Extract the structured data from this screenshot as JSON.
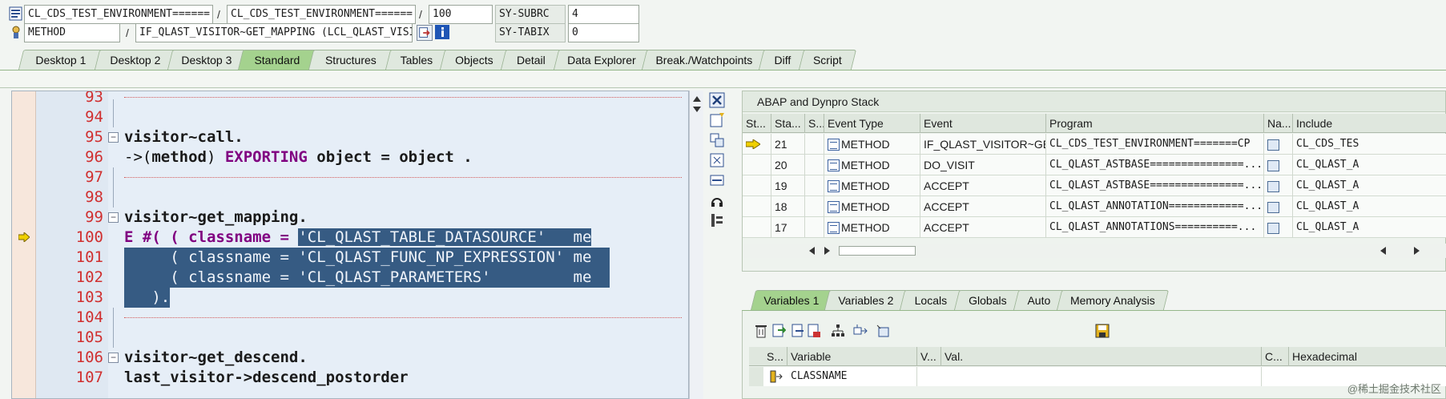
{
  "header": {
    "row1": {
      "program": "CL_CDS_TEST_ENVIRONMENT======",
      "include": "CL_CDS_TEST_ENVIRONMENT======",
      "line": "100",
      "sysvar_label": "SY-SUBRC",
      "sysvar_value": "4"
    },
    "row2": {
      "event_type": "METHOD",
      "event": "IF_QLAST_VISITOR~GET_MAPPING (LCL_QLAST_VISI...",
      "sysvar_label": "SY-TABIX",
      "sysvar_value": "0"
    },
    "separator": "/"
  },
  "tabs": [
    "Desktop 1",
    "Desktop 2",
    "Desktop 3",
    "Standard",
    "Structures",
    "Tables",
    "Objects",
    "Detail",
    "Data Explorer",
    "Break./Watchpoints",
    "Diff",
    "Script"
  ],
  "active_tab": "Standard",
  "editor": {
    "lines": [
      {
        "n": "93"
      },
      {
        "n": "94"
      },
      {
        "n": "95"
      },
      {
        "n": "96"
      },
      {
        "n": "97"
      },
      {
        "n": "98"
      },
      {
        "n": "99"
      },
      {
        "n": "100"
      },
      {
        "n": "101"
      },
      {
        "n": "102"
      },
      {
        "n": "103"
      },
      {
        "n": "104"
      },
      {
        "n": "105"
      },
      {
        "n": "106"
      },
      {
        "n": "107"
      }
    ],
    "code": {
      "l95": "visitor~call.",
      "l96_a": "->(",
      "l96_b": "method",
      "l96_c": ") ",
      "l96_d": "EXPORTING",
      "l96_e": " object = object .",
      "l99": "visitor~get_mapping.",
      "l100_a": "E #( ( classname = ",
      "l100_b": "'CL_QLAST_TABLE_DATASOURCE'   me",
      "l101_a": "     ( classname = ",
      "l101_b": "'CL_QLAST_FUNC_NP_EXPRESSION' me",
      "l102_a": "     ( classname = ",
      "l102_b": "'CL_QLAST_PARAMETERS'         me",
      "l103": "   ).",
      "l106": "visitor~get_descend.",
      "l107": "last_visitor->descend_postorder"
    }
  },
  "stack": {
    "title": "ABAP and Dynpro Stack",
    "columns": [
      "St...",
      "Sta...",
      "S...",
      "Event Type",
      "Event",
      "Program",
      "Na...",
      "Include"
    ],
    "rows": [
      {
        "level": "21",
        "type": "METHOD",
        "event": "IF_QLAST_VISITOR~GE...",
        "program": "CL_CDS_TEST_ENVIRONMENT=======CP",
        "include": "CL_CDS_TES",
        "current": true
      },
      {
        "level": "20",
        "type": "METHOD",
        "event": "DO_VISIT",
        "program": "CL_QLAST_ASTBASE===============...",
        "include": "CL_QLAST_A",
        "current": false
      },
      {
        "level": "19",
        "type": "METHOD",
        "event": "ACCEPT",
        "program": "CL_QLAST_ASTBASE===============...",
        "include": "CL_QLAST_A",
        "current": false
      },
      {
        "level": "18",
        "type": "METHOD",
        "event": "ACCEPT",
        "program": "CL_QLAST_ANNOTATION============...",
        "include": "CL_QLAST_A",
        "current": false
      },
      {
        "level": "17",
        "type": "METHOD",
        "event": "ACCEPT",
        "program": "CL_QLAST_ANNOTATIONS==========...",
        "include": "CL_QLAST_A",
        "current": false
      }
    ]
  },
  "variables": {
    "tabs": [
      "Variables 1",
      "Variables 2",
      "Locals",
      "Globals",
      "Auto",
      "Memory Analysis"
    ],
    "active_tab": "Variables 1",
    "columns": [
      "S...",
      "Variable",
      "V...",
      "Val.",
      "C...",
      "Hexadecimal"
    ],
    "rows": [
      {
        "variable": "CLASSNAME"
      }
    ]
  },
  "watermark": "@稀土掘金技术社区"
}
